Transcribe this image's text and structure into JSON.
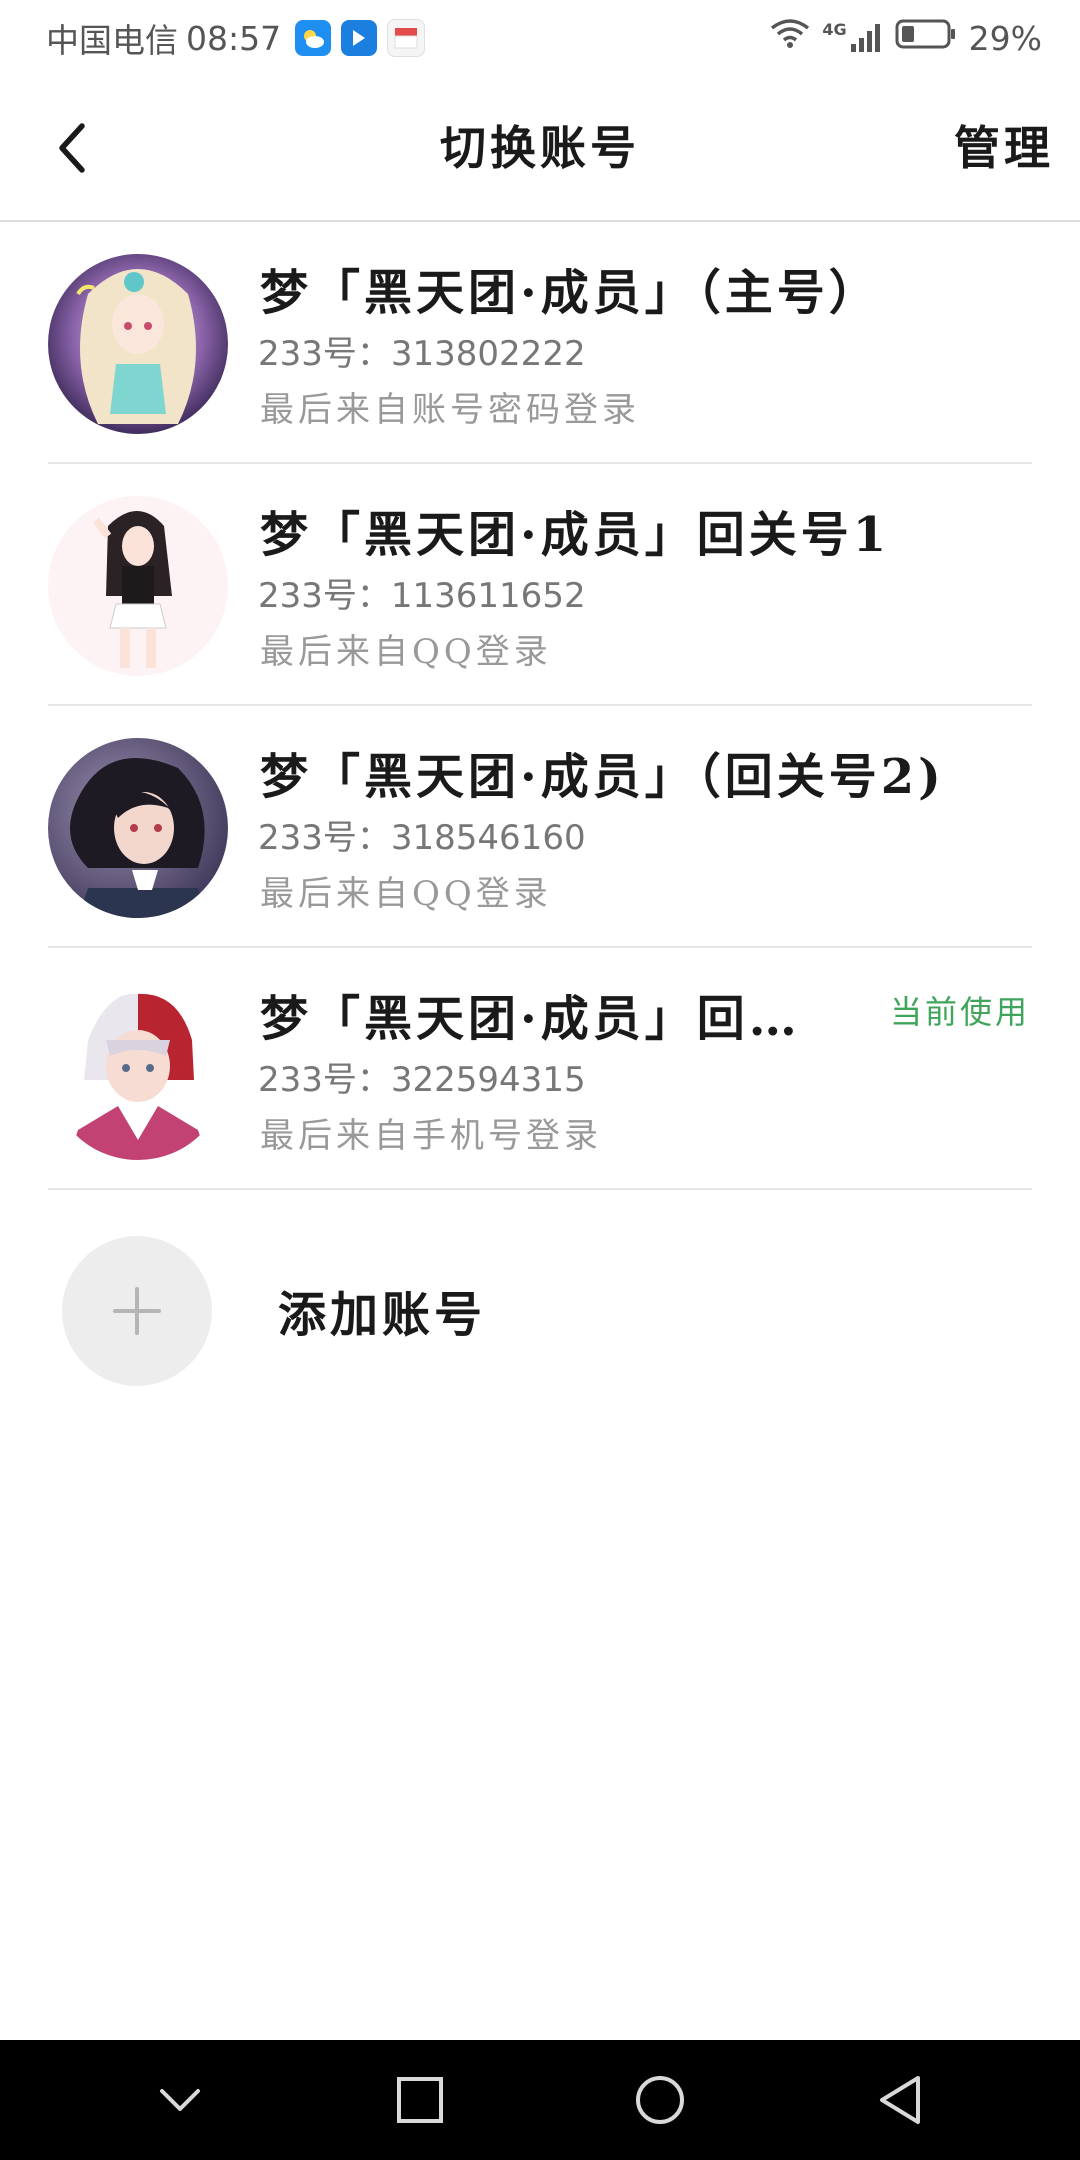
{
  "status_bar": {
    "carrier": "中国电信",
    "time": "08:57",
    "network_type": "4G",
    "battery_percent": "29%",
    "battery_level": 0.29
  },
  "header": {
    "back_icon": "chevron-left-icon",
    "title": "切换账号",
    "manage_label": "管理"
  },
  "accounts": [
    {
      "name": "梦「黑天团·成员」（主号）",
      "id_text": "233号：313802222",
      "login_text": "最后来自账号密码登录",
      "current": false
    },
    {
      "name": "梦「黑天团·成员」回关号1",
      "id_text": "233号：113611652",
      "login_text": "最后来自QQ登录",
      "current": false
    },
    {
      "name": "梦「黑天团·成员」（回关号2)",
      "id_text": "233号：318546160",
      "login_text": "最后来自QQ登录",
      "current": false
    },
    {
      "name": "梦「黑天团·成员」回…",
      "id_text": "233号：322594315",
      "login_text": "最后来自手机号登录",
      "current": true,
      "current_label": "当前使用"
    }
  ],
  "add_account": {
    "icon": "plus-icon",
    "label": "添加账号"
  },
  "colors": {
    "current_badge": "#3fa55b",
    "divider": "#e6e6e6",
    "nav_bar": "#000000"
  },
  "nav_bar": {
    "buttons": [
      "hide-keyboard-icon",
      "recents-icon",
      "home-icon",
      "back-icon"
    ]
  }
}
